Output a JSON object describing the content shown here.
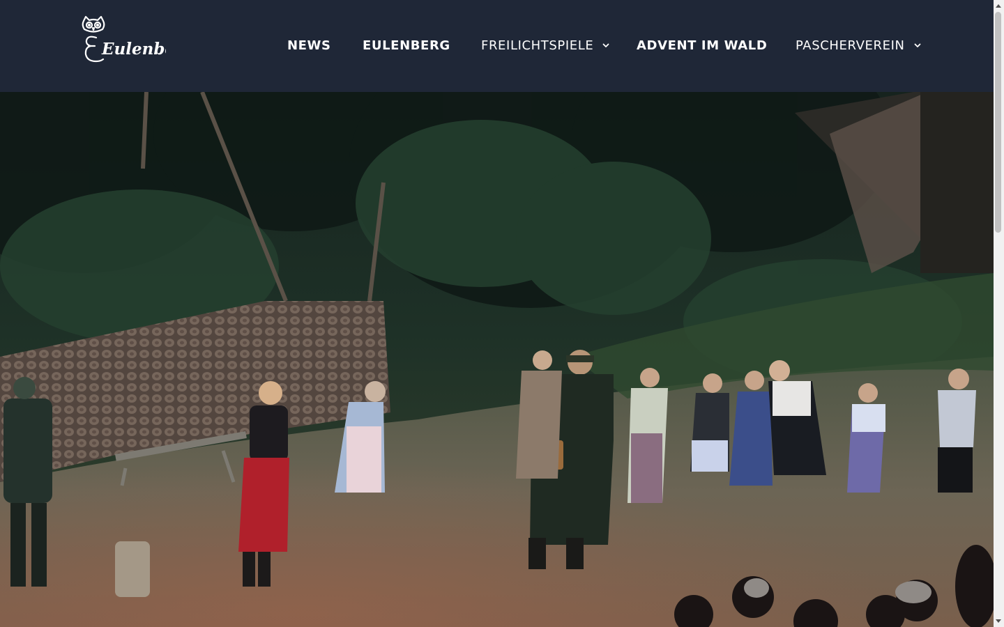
{
  "site": {
    "logo_text": "Eulenberg",
    "logo_icon": "owl-icon"
  },
  "nav": {
    "items": [
      {
        "label": "NEWS",
        "has_dropdown": false
      },
      {
        "label": "EULENBERG",
        "has_dropdown": false
      },
      {
        "label": "FREILICHTSPIELE",
        "has_dropdown": true
      },
      {
        "label": "ADVENT IM WALD",
        "has_dropdown": false
      },
      {
        "label": "PASCHERVEREIN",
        "has_dropdown": true
      }
    ]
  },
  "hero": {
    "image": "open-air-theater-forest-scene"
  },
  "colors": {
    "header_bg": "#1f2737",
    "nav_text": "#ffffff",
    "scrollbar_track": "#f1f1f1",
    "scrollbar_thumb": "#c1c1c1"
  }
}
